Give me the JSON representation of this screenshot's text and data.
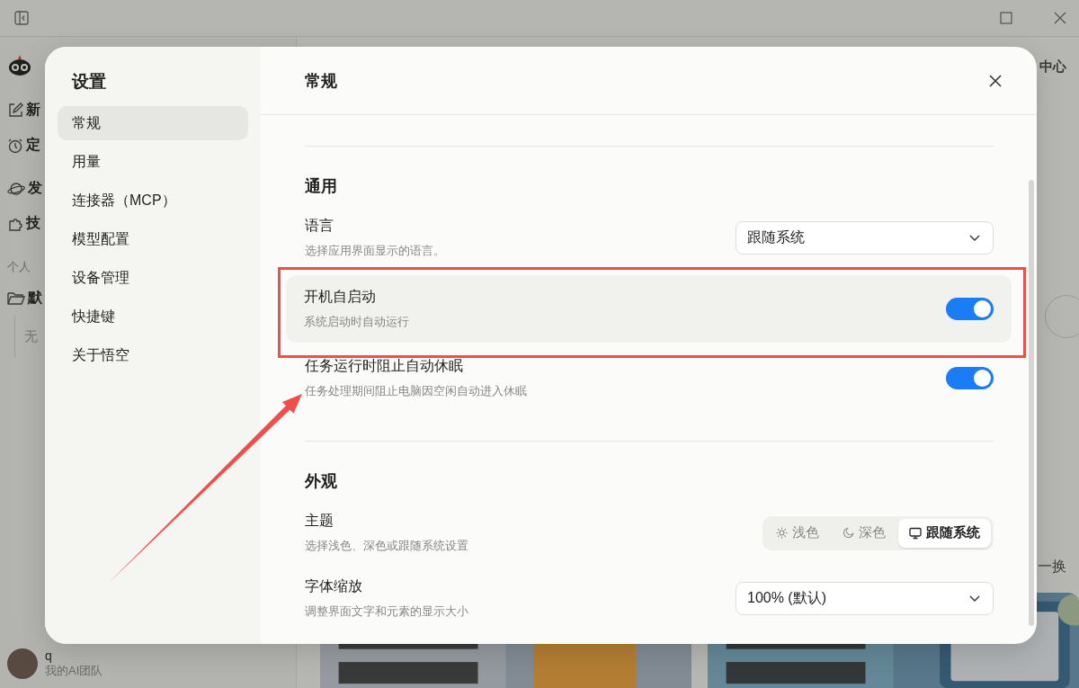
{
  "app": {
    "sidebar": {
      "items": [
        {
          "label": "新"
        },
        {
          "label": "定"
        },
        {
          "label": "发"
        },
        {
          "label": "技"
        }
      ],
      "section_label": "个人",
      "folder": "默",
      "empty": "无",
      "user": {
        "name": "q",
        "team": "我的AI团队"
      }
    },
    "main": {
      "header_text": "中心",
      "side_text": "一换"
    }
  },
  "settings": {
    "title": "设置",
    "nav": [
      {
        "label": "常规",
        "selected": true
      },
      {
        "label": "用量",
        "selected": false
      },
      {
        "label": "连接器（MCP）",
        "selected": false
      },
      {
        "label": "模型配置",
        "selected": false
      },
      {
        "label": "设备管理",
        "selected": false
      },
      {
        "label": "快捷键",
        "selected": false
      },
      {
        "label": "关于悟空",
        "selected": false
      }
    ],
    "page_title": "常规",
    "sections": [
      {
        "title": "通用",
        "rows": [
          {
            "kind": "select",
            "label": "语言",
            "description": "选择应用界面显示的语言。",
            "value": "跟随系统",
            "highlighted": false
          },
          {
            "kind": "toggle",
            "label": "开机自启动",
            "description": "系统启动时自动运行",
            "on": true,
            "highlighted": true
          },
          {
            "kind": "toggle",
            "label": "任务运行时阻止自动休眠",
            "description": "任务处理期间阻止电脑因空闲自动进入休眠",
            "on": true,
            "highlighted": false
          }
        ]
      },
      {
        "title": "外观",
        "rows": [
          {
            "kind": "segmented",
            "label": "主题",
            "description": "选择浅色、深色或跟随系统设置",
            "options": [
              {
                "label": "浅色",
                "selected": false
              },
              {
                "label": "深色",
                "selected": false
              },
              {
                "label": "跟随系统",
                "selected": true
              }
            ],
            "highlighted": false
          },
          {
            "kind": "select",
            "label": "字体缩放",
            "description": "调整界面文字和元素的显示大小",
            "value": "100% (默认)",
            "highlighted": false
          }
        ]
      }
    ]
  }
}
